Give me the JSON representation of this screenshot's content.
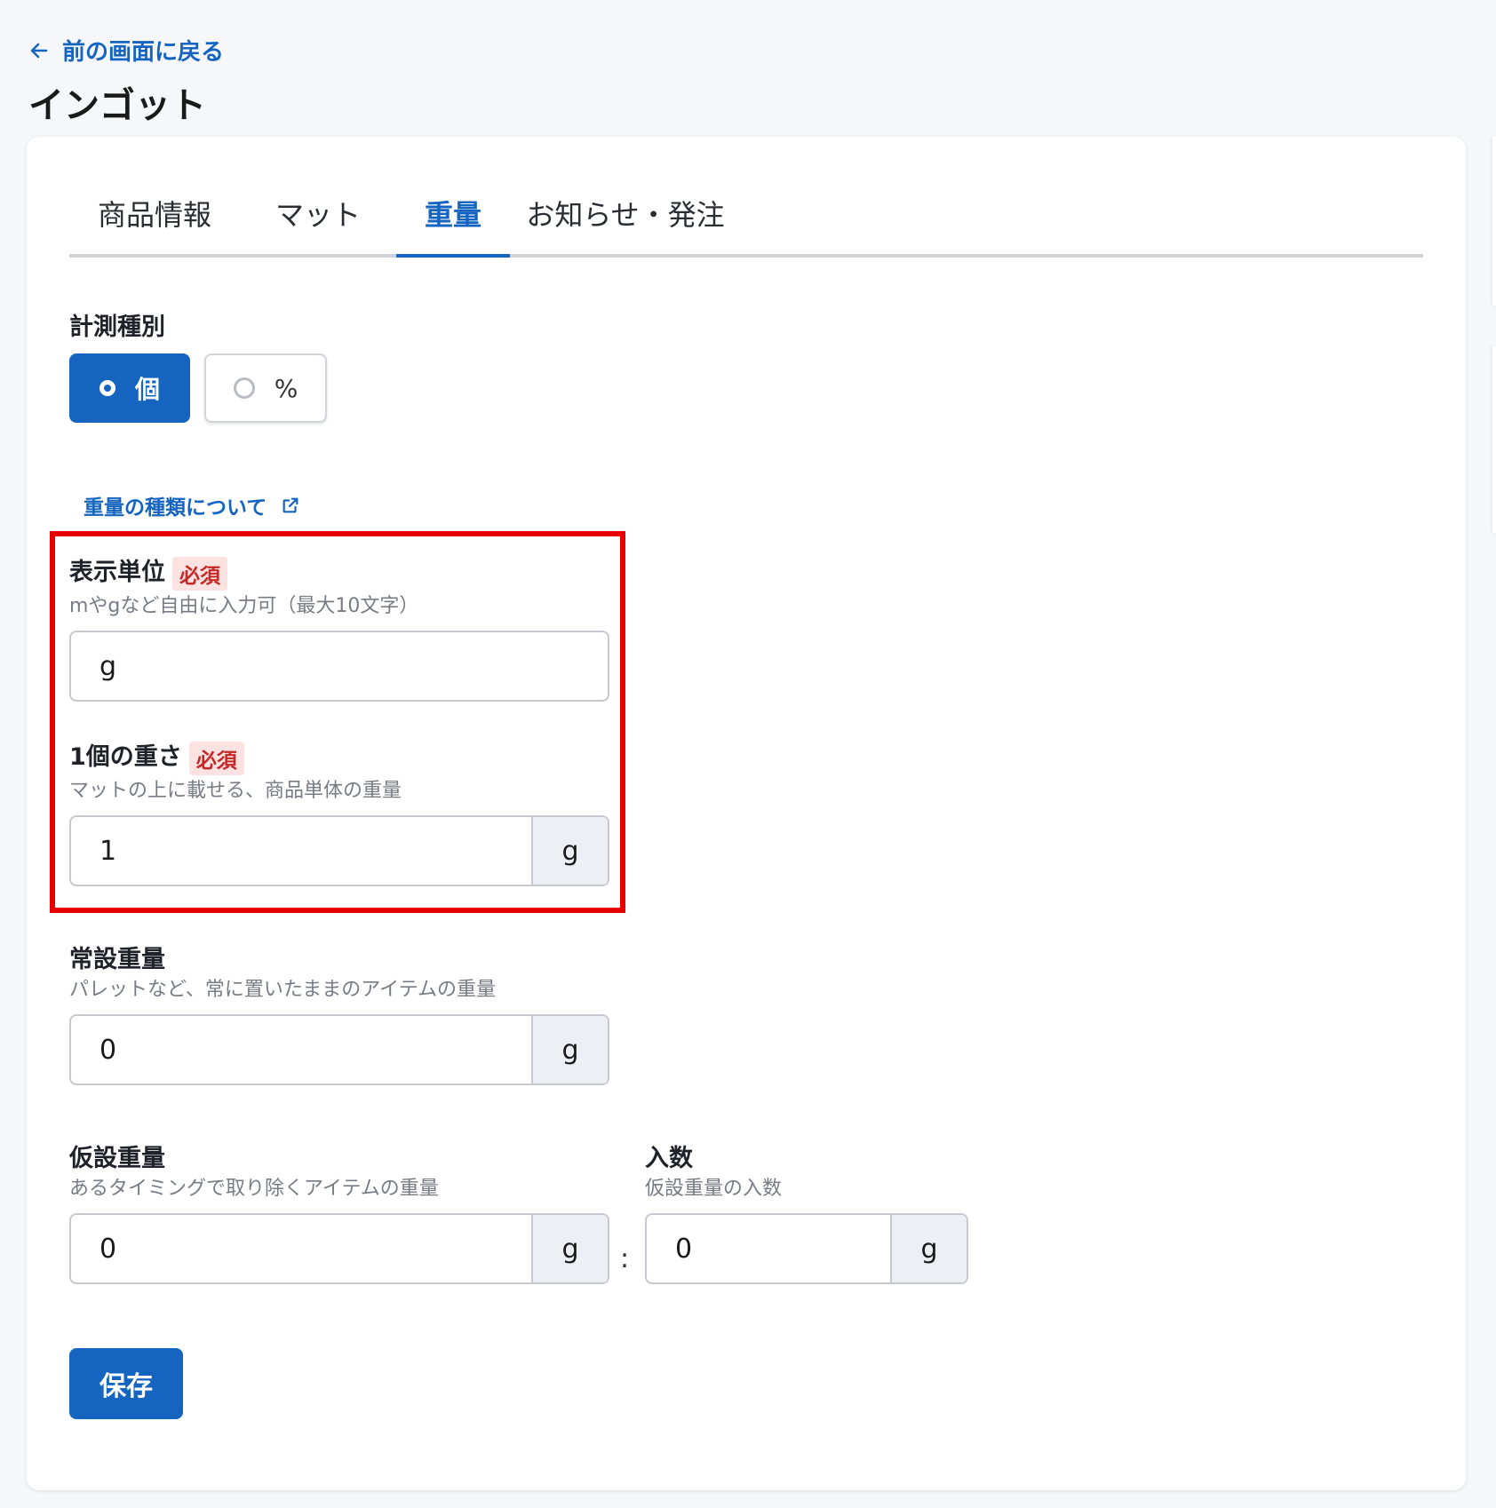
{
  "back_link": {
    "label": "前の画面に戻る",
    "icon": "arrow-left-icon"
  },
  "page_title": "インゴット",
  "tabs": [
    {
      "label": "商品情報",
      "active": false
    },
    {
      "label": "マット",
      "active": false
    },
    {
      "label": "重量",
      "active": true
    },
    {
      "label": "お知らせ・発注",
      "active": false
    }
  ],
  "measurement_type": {
    "label": "計測種別",
    "options": [
      {
        "label": "個",
        "selected": true
      },
      {
        "label": "%",
        "selected": false
      }
    ]
  },
  "help_link": {
    "label": "重量の種類について",
    "icon": "external-link-icon"
  },
  "display_unit": {
    "label": "表示単位",
    "required": "必須",
    "hint": "mやgなど自由に入力可（最大10文字）",
    "value": "g"
  },
  "unit_weight": {
    "label": "1個の重さ",
    "required": "必須",
    "hint": "マットの上に載せる、商品単体の重量",
    "value": "1",
    "unit": "g"
  },
  "permanent_weight": {
    "label": "常設重量",
    "hint": "パレットなど、常に置いたままのアイテムの重量",
    "value": "0",
    "unit": "g"
  },
  "temporary_weight": {
    "label": "仮設重量",
    "hint": "あるタイミングで取り除くアイテムの重量",
    "value": "0",
    "unit": "g"
  },
  "separator": ":",
  "quantity": {
    "label": "入数",
    "hint": "仮設重量の入数",
    "value": "0",
    "unit": "g"
  },
  "save_button": "保存",
  "colors": {
    "primary": "#1565c0",
    "highlight_border": "#e80000",
    "required_bg": "#fde2e2",
    "required_text": "#c62828"
  }
}
